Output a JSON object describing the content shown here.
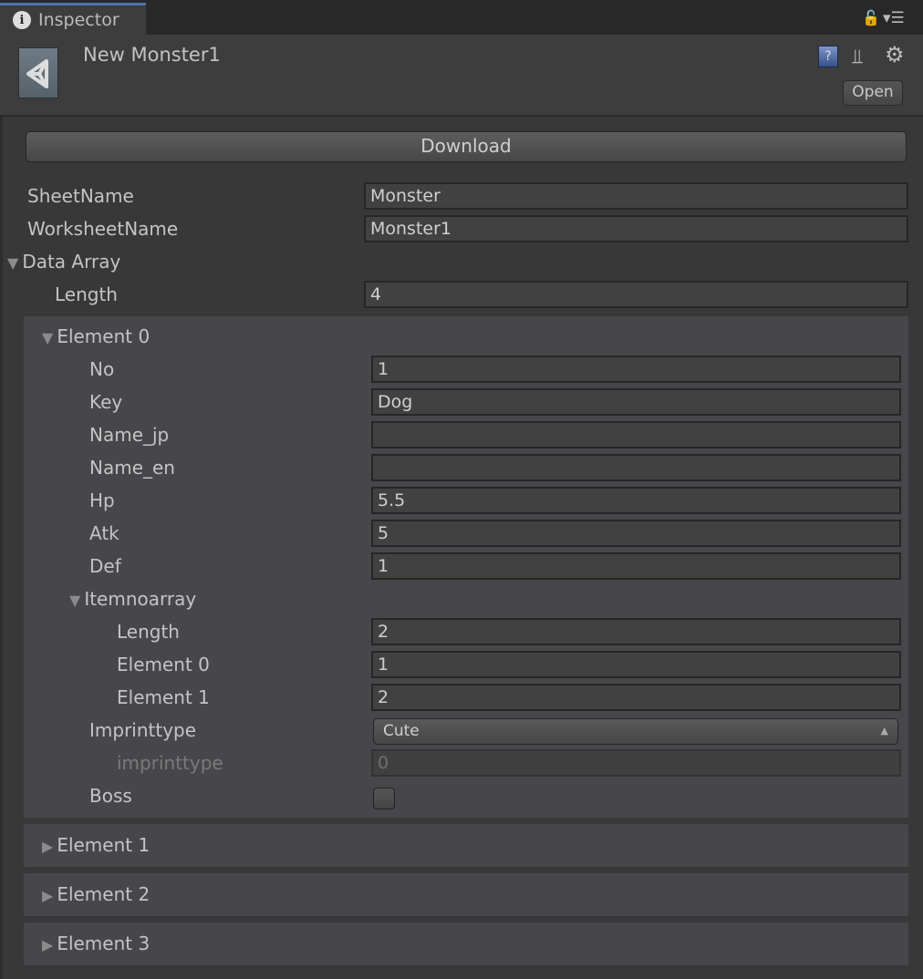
{
  "tab": {
    "label": "Inspector",
    "icon": "info-icon"
  },
  "header": {
    "title": "New Monster1",
    "open_label": "Open",
    "help_glyph": "?"
  },
  "toolbar": {
    "download_label": "Download"
  },
  "fields": {
    "sheet_name": {
      "label": "SheetName",
      "value": "Monster"
    },
    "worksheet_name": {
      "label": "WorksheetName",
      "value": "Monster1"
    },
    "data_array": {
      "label": "Data Array",
      "length_label": "Length",
      "length": "4"
    }
  },
  "element0": {
    "label": "Element 0",
    "no": {
      "label": "No",
      "value": "1"
    },
    "key": {
      "label": "Key",
      "value": "Dog"
    },
    "name_jp": {
      "label": "Name_jp",
      "value": ""
    },
    "name_en": {
      "label": "Name_en",
      "value": ""
    },
    "hp": {
      "label": "Hp",
      "value": "5.5"
    },
    "atk": {
      "label": "Atk",
      "value": "5"
    },
    "def": {
      "label": "Def",
      "value": "1"
    },
    "itemnoarray": {
      "label": "Itemnoarray",
      "length_label": "Length",
      "length": "2",
      "e0_label": "Element 0",
      "e0": "1",
      "e1_label": "Element 1",
      "e1": "2"
    },
    "imprinttype": {
      "label": "Imprinttype",
      "selected": "Cute",
      "sub_label": "imprinttype",
      "sub_value": "0"
    },
    "boss": {
      "label": "Boss",
      "checked": false
    }
  },
  "collapsed": [
    "Element 1",
    "Element 2",
    "Element 3"
  ],
  "colors": {
    "background": "#383838",
    "element_box": "#47474b",
    "tab_accent": "#4c72b5"
  }
}
